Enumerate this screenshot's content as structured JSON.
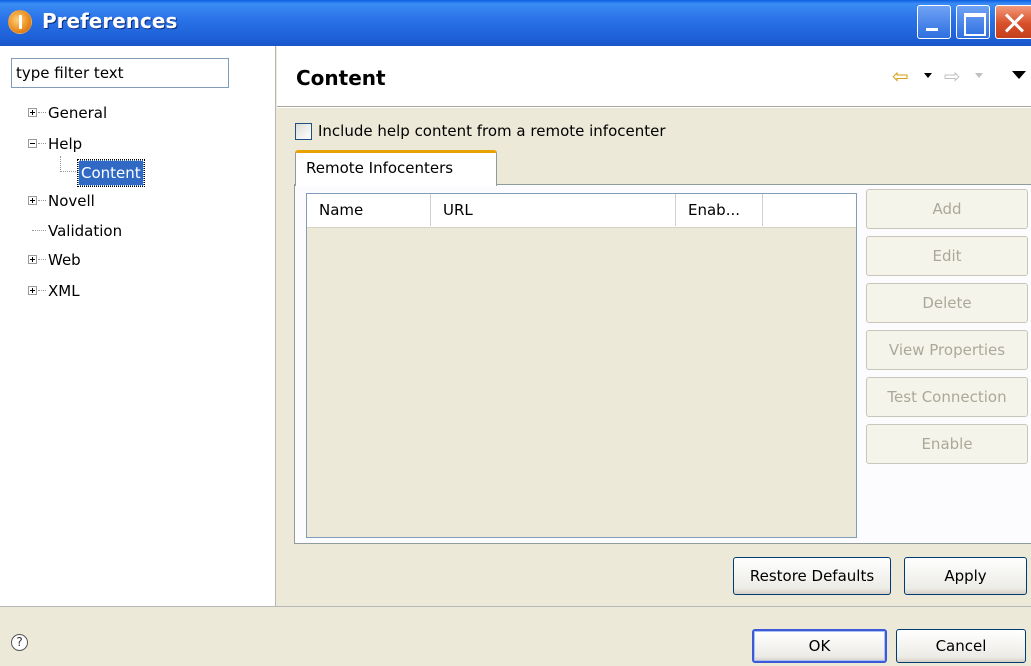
{
  "window": {
    "title": "Preferences"
  },
  "filter": {
    "placeholder": "type filter text"
  },
  "tree": {
    "items": [
      {
        "label": "General",
        "expandable": true
      },
      {
        "label": "Help",
        "expandable": true,
        "expanded": true
      },
      {
        "label": "Content",
        "selected": true
      },
      {
        "label": "Novell",
        "expandable": true
      },
      {
        "label": "Validation",
        "expandable": false
      },
      {
        "label": "Web",
        "expandable": true
      },
      {
        "label": "XML",
        "expandable": true
      }
    ]
  },
  "page": {
    "title": "Content",
    "remote_checkbox_label": "Include help content from a remote infocenter",
    "tab_label": "Remote Infocenters",
    "table": {
      "columns": [
        "Name",
        "URL",
        "Enab..."
      ]
    },
    "side_buttons": [
      "Add",
      "Edit",
      "Delete",
      "View Properties",
      "Test Connection",
      "Enable"
    ],
    "restore_defaults_label": "Restore Defaults",
    "apply_label": "Apply"
  },
  "footer": {
    "ok_label": "OK",
    "cancel_label": "Cancel",
    "help_icon": "?"
  },
  "colors": {
    "titlebar": "#245edb",
    "selection": "#316ac5",
    "tab_accent": "#e8a202"
  }
}
